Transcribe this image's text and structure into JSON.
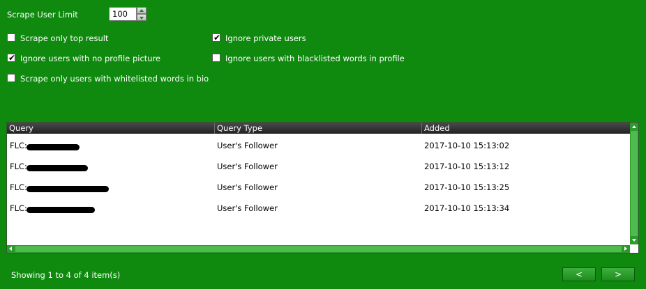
{
  "scrape_limit": {
    "label": "Scrape User Limit",
    "value": "100"
  },
  "options": {
    "top_result": {
      "label": "Scrape only top result",
      "checked": false
    },
    "private_users": {
      "label": "Ignore private users",
      "checked": true
    },
    "no_profile_picture": {
      "label": "Ignore users with no profile picture",
      "checked": true
    },
    "blacklisted_words": {
      "label": "Ignore users with blacklisted words in profile",
      "checked": false
    },
    "whitelisted_words": {
      "label": "Scrape only users with whitelisted words in bio",
      "checked": false
    }
  },
  "grid": {
    "columns": [
      "Query",
      "Query Type",
      "Added"
    ],
    "rows": [
      {
        "query": "FLC:",
        "type": "User's Follower",
        "added": "2017-10-10 15:13:02"
      },
      {
        "query": "FLC:",
        "type": "User's Follower",
        "added": "2017-10-10 15:13:12"
      },
      {
        "query": "FLC:",
        "type": "User's Follower",
        "added": "2017-10-10 15:13:25"
      },
      {
        "query": "FLC:",
        "type": "User's Follower",
        "added": "2017-10-10 15:13:34"
      }
    ]
  },
  "footer": {
    "status": "Showing 1 to 4 of 4 item(s)",
    "prev": "<",
    "next": ">"
  },
  "colors": {
    "background": "#0f8a0f",
    "header": "#2b2b2b"
  }
}
